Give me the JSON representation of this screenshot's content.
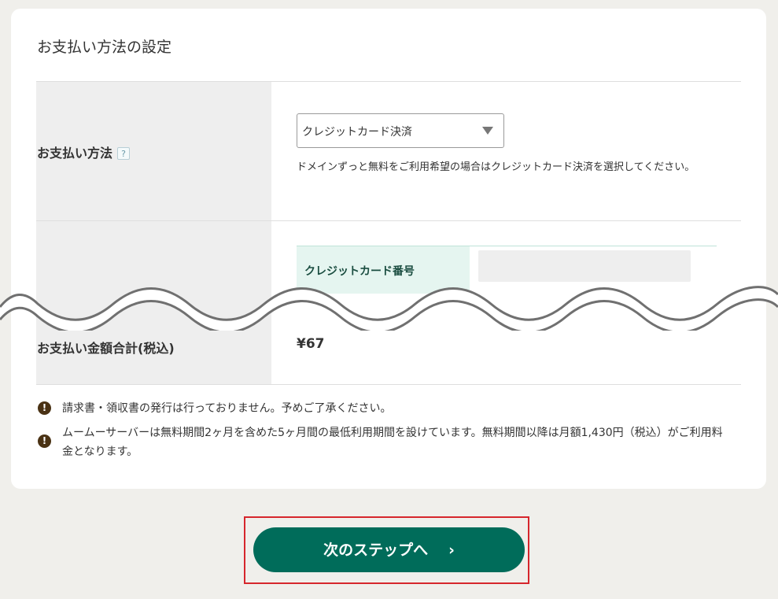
{
  "payment_settings": {
    "title": "お支払い方法の設定",
    "method": {
      "label": "お支払い方法",
      "help_icon": "question-mark-icon",
      "help_glyph": "?",
      "selected": "クレジットカード決済",
      "note": "ドメインずっと無料をご利用希望の場合はクレジットカード決済を選択してください。"
    },
    "credit_card": {
      "number_label": "クレジットカード番号",
      "number_value": ""
    },
    "total": {
      "label": "お支払い金額合計(税込)",
      "value": "¥67"
    },
    "notices": [
      {
        "icon": "exclamation-icon",
        "glyph": "!",
        "text": "請求書・領収書の発行は行っておりません。予めご了承ください。"
      },
      {
        "icon": "exclamation-icon",
        "glyph": "!",
        "text": "ムームーサーバーは無料期間2ヶ月を含めた5ヶ月間の最低利用期間を設けています。無料期間以降は月額1,430円（税込）がご利用料金となります。"
      }
    ]
  },
  "actions": {
    "next_label": "次のステップへ",
    "next_chevron": "›"
  },
  "colors": {
    "page_background": "#f0efeb",
    "card_background": "#ffffff",
    "label_cell": "#eeeeee",
    "cc_label_cell": "#e5f5f0",
    "primary_button": "#006c5a",
    "notice_icon": "#4a3214",
    "highlight_frame": "#d6262c"
  }
}
